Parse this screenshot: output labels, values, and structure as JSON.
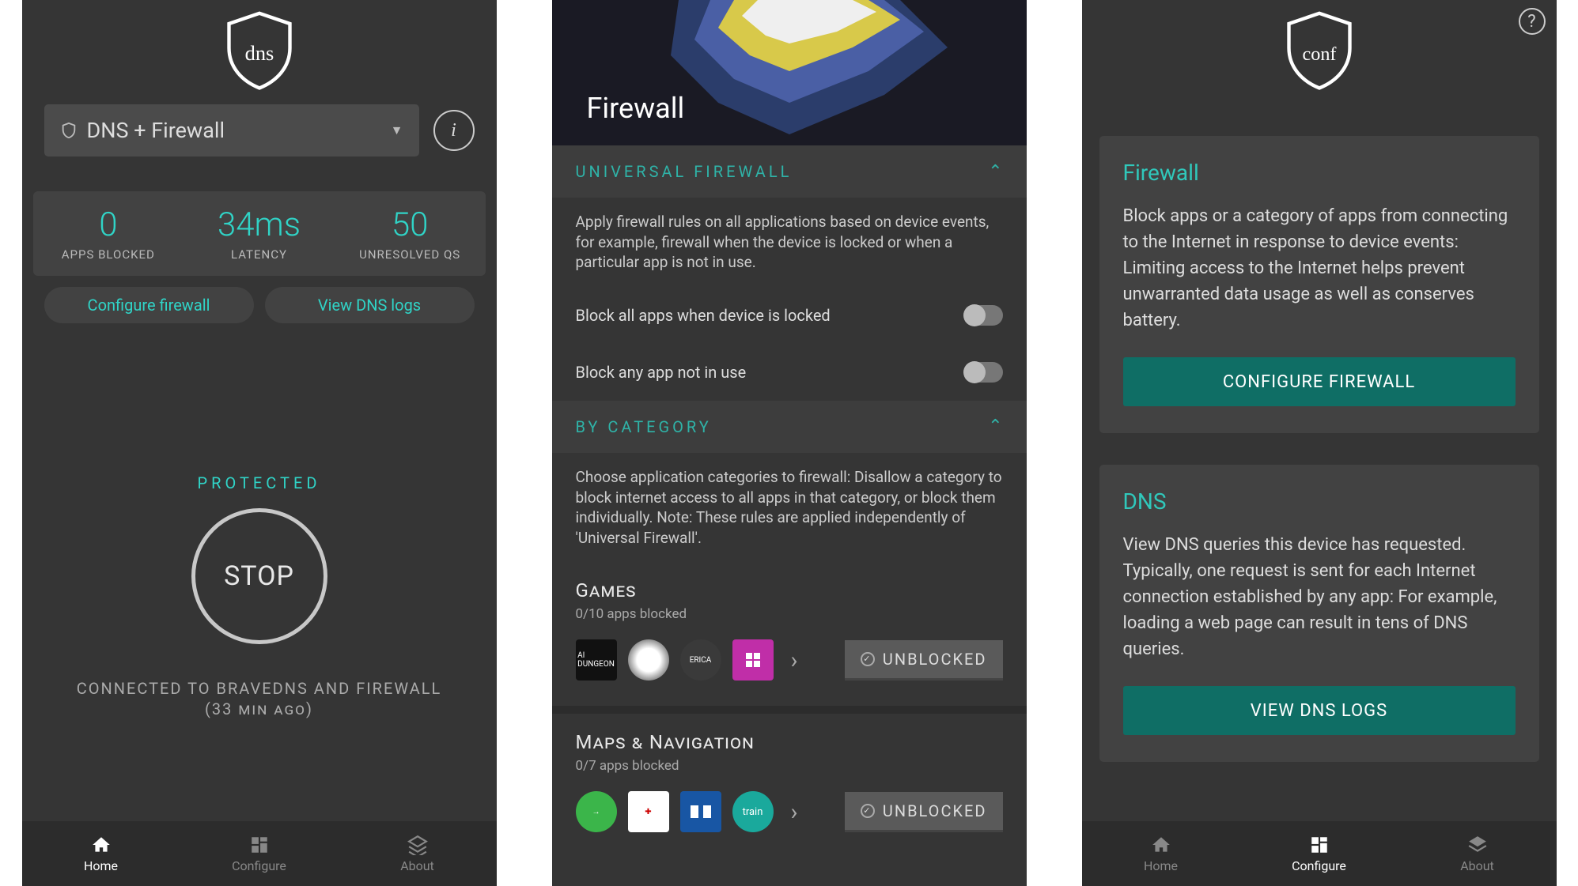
{
  "s1": {
    "logo_text": "dns",
    "mode_label": "DNS + Firewall",
    "stats": {
      "blocked_val": "0",
      "blocked_lbl": "APPS BLOCKED",
      "latency_val": "34ms",
      "latency_lbl": "LATENCY",
      "unres_val": "50",
      "unres_lbl": "UNRESOLVED QS"
    },
    "btn_configure": "Configure firewall",
    "btn_logs": "View DNS logs",
    "protected": "PROTECTED",
    "stop": "STOP",
    "connected_line1": "CONNECTED TO BRAVEDNS AND FIREWALL",
    "connected_line2": "(33 min ago)",
    "nav": {
      "home": "Home",
      "configure": "Configure",
      "about": "About"
    }
  },
  "s2": {
    "hero": "Firewall",
    "uni": {
      "title": "UNIVERSAL FIREWALL",
      "desc": "Apply firewall rules on all applications based on device events, for example, firewall when the device is locked or when a particular app is not in use.",
      "t1": "Block all apps when device is locked",
      "t2": "Block any app not in use"
    },
    "bycat": {
      "title": "BY CATEGORY",
      "desc": "Choose application categories to firewall: Disallow a category to block internet access to all apps in that category, or block them individually. Note: These rules are applied independently of 'Universal Firewall'."
    },
    "cat1": {
      "title": "Games",
      "sub": "0/10 apps blocked",
      "btn": "UNBLOCKED"
    },
    "cat2": {
      "title": "Maps & Navigation",
      "sub": "0/7 apps blocked",
      "btn": "UNBLOCKED"
    }
  },
  "s3": {
    "logo_text": "conf",
    "fw": {
      "h": "Firewall",
      "d": "Block apps or a category of apps from connecting to the Internet in response to device events: Limiting access to the Internet helps prevent unwarranted data usage as well as conserves battery.",
      "btn": "CONFIGURE FIREWALL"
    },
    "dns": {
      "h": "DNS",
      "d": "View DNS queries this device has requested. Typically, one request is sent for each Internet connection established by any app: For example, loading a web page can result in tens of DNS queries.",
      "btn": "VIEW DNS LOGS"
    },
    "nav": {
      "home": "Home",
      "configure": "Configure",
      "about": "About"
    }
  }
}
